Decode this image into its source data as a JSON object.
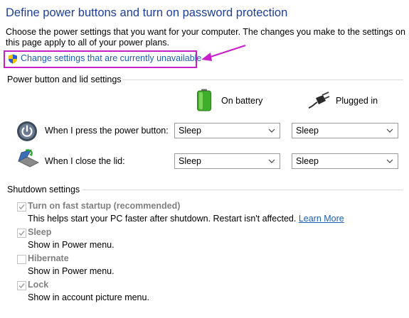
{
  "header": {
    "title": "Define power buttons and turn on password protection",
    "description": "Choose the power settings that you want for your computer. The changes you make to the settings on this page apply to all of your power plans.",
    "change_settings_link": "Change settings that are currently unavailable"
  },
  "power_lid": {
    "section_title": "Power button and lid settings",
    "columns": [
      "On battery",
      "Plugged in"
    ],
    "rows": [
      {
        "label": "When I press the power button:",
        "on_battery": "Sleep",
        "plugged_in": "Sleep"
      },
      {
        "label": "When I close the lid:",
        "on_battery": "Sleep",
        "plugged_in": "Sleep"
      }
    ]
  },
  "shutdown": {
    "section_title": "Shutdown settings",
    "options": [
      {
        "title": "Turn on fast startup (recommended)",
        "description": "This helps start your PC faster after shutdown. Restart isn't affected.",
        "link": "Learn More",
        "checked": true
      },
      {
        "title": "Sleep",
        "description": "Show in Power menu.",
        "checked": true
      },
      {
        "title": "Hibernate",
        "description": "Show in Power menu.",
        "checked": false
      },
      {
        "title": "Lock",
        "description": "Show in account picture menu.",
        "checked": true
      }
    ]
  },
  "colors": {
    "title": "#1e3f99",
    "link": "#1a5fb4",
    "highlight": "#c81fc8",
    "disabled_text": "#808080"
  }
}
